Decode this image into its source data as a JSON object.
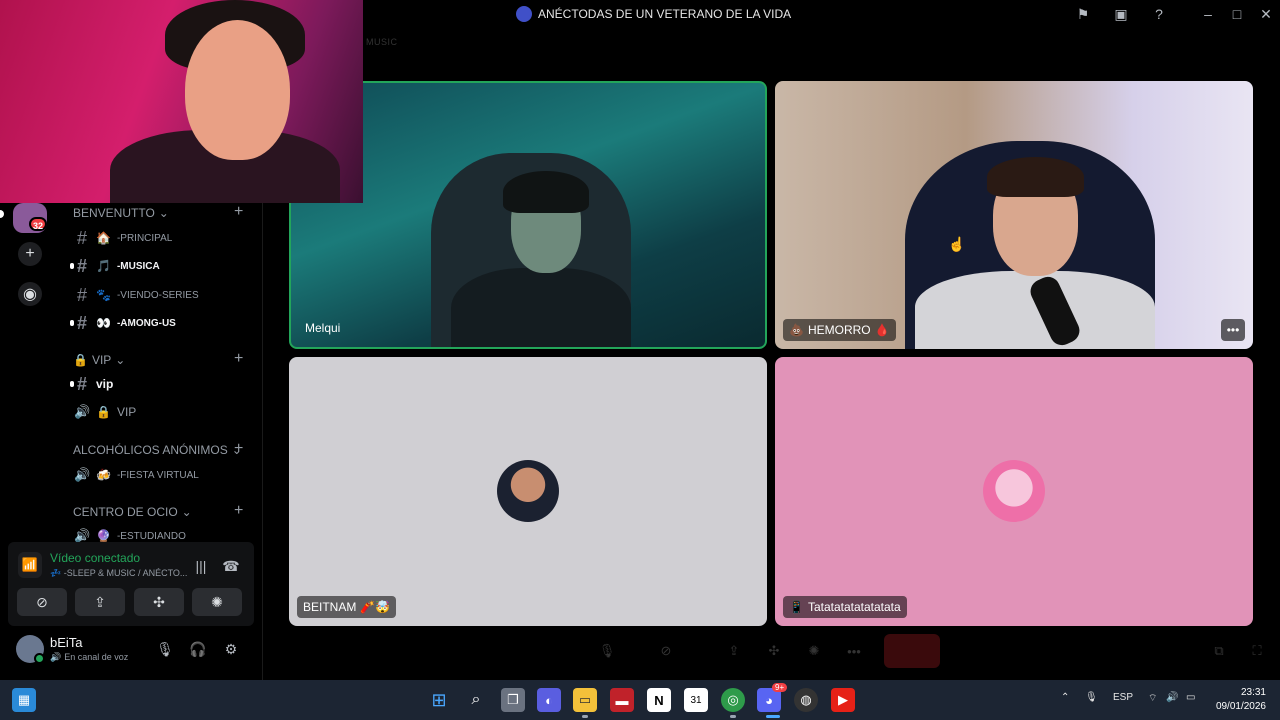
{
  "window": {
    "title": "ANÉCTODAS DE UN VETERANO DE LA VIDA",
    "faded_label": "MUSIC"
  },
  "rail": {
    "badge": "32"
  },
  "sidebar": {
    "categories": [
      {
        "label": "BENVENUTTO"
      },
      {
        "label": "VIP"
      },
      {
        "label": "ALCOHÓLICOS ANÓNIMOS"
      },
      {
        "label": "CENTRO DE OCIO"
      }
    ],
    "channels": [
      {
        "emoji": "🏠",
        "label": "-PRINCIPAL"
      },
      {
        "emoji": "🎵",
        "label": "-MUSICA"
      },
      {
        "emoji": "🐾",
        "label": "-VIENDO-SERIES"
      },
      {
        "emoji": "👀",
        "label": "-AMONG-US"
      },
      {
        "emoji": "",
        "label": "vip"
      },
      {
        "emoji": "🔒",
        "label": "VIP"
      },
      {
        "emoji": "🍻",
        "label": "-FIESTA VIRTUAL"
      },
      {
        "emoji": "🔮",
        "label": "-ESTUDIANDO"
      }
    ],
    "vip_lock": "🔒"
  },
  "voice": {
    "status": "Vídeo conectado",
    "channel": "💤 -SLEEP & MUSIC / ANÉCTO..."
  },
  "user": {
    "name": "bEiTa",
    "status": "En canal de voz"
  },
  "tiles": [
    {
      "name": "Melqui",
      "prefix": "",
      "suffix": ""
    },
    {
      "name": "HEMORRO",
      "prefix": "💩",
      "suffix": "🩸"
    },
    {
      "name": "BEITNAM",
      "prefix": "",
      "suffix": "🧨🤯"
    },
    {
      "name": "Tatatatatatatatata",
      "prefix": "📱",
      "suffix": ""
    }
  ],
  "taskbar": {
    "lang": "ESP",
    "time": "23:31",
    "date": "09/01/2026",
    "discord_badge": "9+"
  },
  "colors": {
    "accent_green": "#23a55a",
    "badge_red": "#f23f43"
  }
}
